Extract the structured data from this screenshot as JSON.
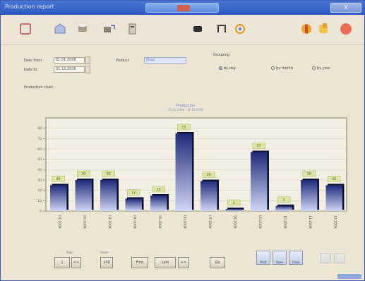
{
  "window": {
    "title": "Production report",
    "close_label": "X"
  },
  "toolbar": {
    "items": [
      {
        "name": "new-icon"
      },
      {
        "name": "open-icon"
      },
      {
        "name": "print-icon"
      },
      {
        "name": "export-icon"
      },
      {
        "name": "filter-icon"
      },
      {
        "name": "stop-icon"
      },
      {
        "name": "columns-icon"
      },
      {
        "name": "refresh-icon"
      },
      {
        "name": "chart-icon"
      },
      {
        "name": "settings-icon"
      },
      {
        "name": "exit-icon"
      }
    ]
  },
  "form": {
    "from_label": "Date from",
    "from_value": "01.01.2008",
    "to_label": "Date to",
    "to_value": "31.12.2008",
    "product_label": "Product",
    "product_value": "Steel",
    "group_label": "Grouping",
    "radio_day": "by day",
    "radio_month": "by month",
    "radio_year": "by year",
    "selected_radio": "day",
    "section_label": "Production chart"
  },
  "chart_data": {
    "type": "bar",
    "title": "Production",
    "subtitle": "01.01.2008 - 31.12.2008",
    "categories": [
      "01.2008",
      "02.2008",
      "03.2008",
      "04.2008",
      "05.2008",
      "06.2008",
      "07.2008",
      "08.2008",
      "09.2008",
      "10.2008",
      "11.2008",
      "12.2008"
    ],
    "values": [
      25,
      30,
      30,
      12,
      15,
      75,
      29,
      2,
      57,
      5,
      30,
      25
    ],
    "ylim": [
      0,
      90
    ],
    "yticks": [
      0,
      10,
      20,
      30,
      40,
      50,
      60,
      70,
      80
    ],
    "grid": true,
    "data_labels": true,
    "colors": {
      "bar_top": "#1f2a78",
      "bar_bottom": "#cfd6f5",
      "label_bg": "#dce5a4",
      "frame": "#a5a28f"
    }
  },
  "bottom": {
    "group_label": "Page",
    "page_value": "1",
    "zoom_label": "Zoom",
    "zoom_value": "100",
    "btn_prev": "<<",
    "btn_next": ">>",
    "btn_first": "First",
    "btn_last": "Last",
    "btn_go": "Go",
    "icon1": "Print",
    "icon2": "Save",
    "icon3": "Close"
  }
}
